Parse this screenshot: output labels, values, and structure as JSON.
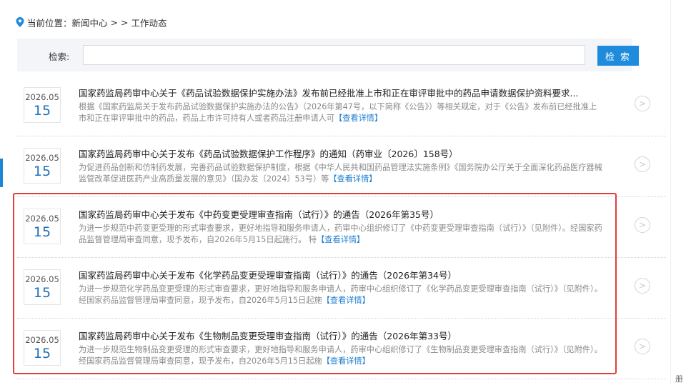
{
  "breadcrumb": {
    "prefix": "当前位置：",
    "home": "新闻中心",
    "sep": "> >",
    "current": "工作动态"
  },
  "search": {
    "label": "检索:",
    "value": "",
    "placeholder": "",
    "button": "检 索"
  },
  "items": [
    {
      "date_ym": "2026.05",
      "date_day": "15",
      "title": "国家药监局药审中心关于《药品试验数据保护实施办法》发布前已经批准上市和正在审评审批中的药品申请数据保护资料要求...",
      "summary": "根据《国家药监局关于发布药品试验数据保护实施办法的公告》（2026年第47号，以下简称《公告》）等相关规定，对于《公告》发布前已经批准上市和正在审评审批中的药品，药品上市许可持有人或者药品注册申请人可",
      "more": "【查看详情】"
    },
    {
      "date_ym": "2026.05",
      "date_day": "15",
      "title": "国家药监局药审中心关于发布《药品试验数据保护工作程序》的通知（药审业〔2026〕158号）",
      "summary": "为促进药品创新和仿制药发展，完善药品试验数据保护制度，根据《中华人民共和国药品管理法实施条例》《国务院办公厅关于全面深化药品医疗器械监管改革促进医药产业高质量发展的意见》（国办发〔2024〕53号）等",
      "more": "【查看详情】"
    },
    {
      "date_ym": "2026.05",
      "date_day": "15",
      "title": "国家药监局药审中心关于发布《中药变更受理审查指南（试行）》的通告（2026年第35号）",
      "summary": "为进一步规范中药变更受理的形式审查要求，更好地指导和服务申请人，药审中心组织修订了《中药变更受理审查指南（试行）》（见附件）。经国家药品监督管理局审查同意，现予发布，自2026年5月15日起施行。 特",
      "more": "【查看详情】"
    },
    {
      "date_ym": "2026.05",
      "date_day": "15",
      "title": "国家药监局药审中心关于发布《化学药品变更受理审查指南（试行）》的通告（2026年第34号）",
      "summary": "为进一步规范化学药品变更受理的形式审查要求，更好地指导和服务申请人，药审中心组织修订了《化学药品变更受理审查指南（试行）》（见附件）。经国家药品监督管理局审查同意，现予发布，自2026年5月15日起施",
      "more": "【查看详情】"
    },
    {
      "date_ym": "2026.05",
      "date_day": "15",
      "title": "国家药监局药审中心关于发布《生物制品变更受理审查指南（试行）》的通告（2026年第33号）",
      "summary": "为进一步规范生物制品变更受理的形式审查要求，更好地指导和服务申请人，药审中心组织修订了《生物制品变更受理审查指南（试行）》（见附件）。经国家药品监督管理局审查同意，现予发布，自2026年5月15日起施",
      "more": "【查看详情】"
    }
  ],
  "side_glyph": "册",
  "colors": {
    "accent": "#1e8bdd",
    "highlight": "#e23c3c",
    "link": "#1e7ed0"
  }
}
